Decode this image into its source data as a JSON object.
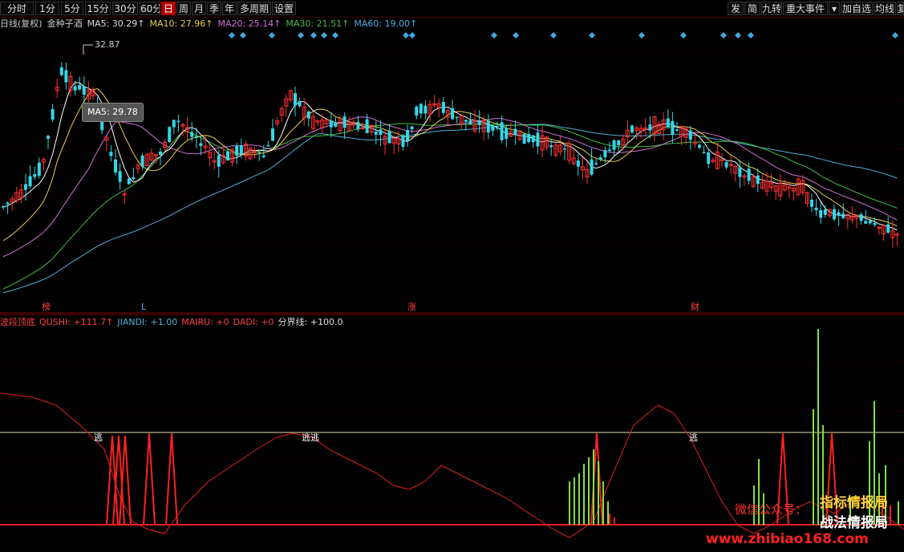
{
  "toolbar": {
    "left_buttons": [
      "分时",
      "1分",
      "5分",
      "15分",
      "30分",
      "60分",
      "日",
      "周",
      "月",
      "季",
      "年",
      "多周期",
      "设置"
    ],
    "active": "日",
    "right_buttons": [
      "发",
      "简",
      "九转",
      "重大事件",
      "▾",
      "加自选",
      "均线",
      "复"
    ]
  },
  "info": {
    "period": "日线(复权)",
    "stock": "金种子酒",
    "ma5": "MA5: 30.29↑",
    "ma10": "MA10: 27.96↑",
    "ma20": "MA20: 25.14↑",
    "ma30": "MA30: 21.51↑",
    "ma60": "MA60: 19.00↑"
  },
  "colors": {
    "ma5": "#ffffff",
    "ma10": "#e6d34a",
    "ma20": "#d070d0",
    "ma30": "#40c040",
    "ma60": "#4fb0d8",
    "up": "#ff3030",
    "down": "#30d8e8",
    "diamond": "#3fa8e0"
  },
  "price_chart": {
    "high_label": "32.87",
    "tooltip": "MA5: 29.78",
    "markers": [
      "榜",
      "L",
      "涨",
      "财"
    ]
  },
  "indicator": {
    "name": "波段顶底",
    "qushi": "QUSHI: +111.7↑",
    "jiandi": "JIANDI: +1.00",
    "mairu": "MAIRU: +0",
    "dadi": "DADI: +0",
    "fenjie": "分界线: +100.0",
    "escape_label": "逃",
    "escape_double": "逃逃"
  },
  "watermark": {
    "line1": "指标情报局",
    "line2": "战法情报局",
    "wechat": "微信公众号：",
    "site": "www.zhibiao168.com"
  }
}
